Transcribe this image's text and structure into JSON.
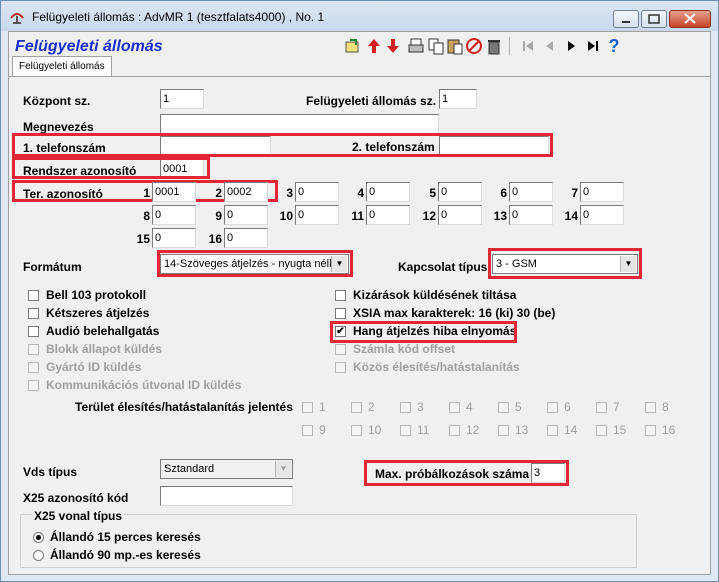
{
  "window": {
    "title": "Felügyeleti állomás : AdvMR 1 (tesztfalats4000) , No. 1"
  },
  "heading": "Felügyeleti állomás",
  "tabs": [
    {
      "label": "Felügyeleti állomás"
    }
  ],
  "fields": {
    "kozpont_label": "Központ sz.",
    "kozpont_value": "1",
    "felugy_label": "Felügyeleti állomás sz.",
    "felugy_value": "1",
    "megnevezes_label": "Megnevezés",
    "megnevezes_value": "",
    "tel1_label": "1. telefonszám",
    "tel1_value": "",
    "tel2_label": "2. telefonszám",
    "tel2_value": "",
    "rendszer_label": "Rendszer azonosító",
    "rendszer_value": "0001",
    "ter_label": "Ter. azonosító"
  },
  "ter_azonosito": [
    {
      "n": "1",
      "v": "0001"
    },
    {
      "n": "2",
      "v": "0002"
    },
    {
      "n": "3",
      "v": "0"
    },
    {
      "n": "4",
      "v": "0"
    },
    {
      "n": "5",
      "v": "0"
    },
    {
      "n": "6",
      "v": "0"
    },
    {
      "n": "7",
      "v": "0"
    },
    {
      "n": "8",
      "v": "0"
    },
    {
      "n": "9",
      "v": "0"
    },
    {
      "n": "10",
      "v": "0"
    },
    {
      "n": "11",
      "v": "0"
    },
    {
      "n": "12",
      "v": "0"
    },
    {
      "n": "13",
      "v": "0"
    },
    {
      "n": "14",
      "v": "0"
    },
    {
      "n": "15",
      "v": "0"
    },
    {
      "n": "16",
      "v": "0"
    }
  ],
  "formatum": {
    "label": "Formátum",
    "value": "14-Szöveges átjelzés - nyugta nélki"
  },
  "kapcsolat": {
    "label": "Kapcsolat típus",
    "value": "3 - GSM"
  },
  "checks_left": [
    {
      "label": "Bell 103 protokoll",
      "checked": false,
      "disabled": false
    },
    {
      "label": "Kétszeres átjelzés",
      "checked": false,
      "disabled": false
    },
    {
      "label": "Audió belehallgatás",
      "checked": false,
      "disabled": false
    },
    {
      "label": "Blokk állapot küldés",
      "checked": false,
      "disabled": true
    },
    {
      "label": "Gyártó ID küldés",
      "checked": false,
      "disabled": true
    },
    {
      "label": "Kommunikációs útvonal ID küldés",
      "checked": false,
      "disabled": true
    }
  ],
  "checks_right": [
    {
      "label": "Kizárások küldésének tiltása",
      "checked": false,
      "disabled": false
    },
    {
      "label": "XSIA max karakterek: 16 (ki) 30 (be)",
      "checked": false,
      "disabled": false
    },
    {
      "label": "Hang átjelzés hiba elnyomás",
      "checked": true,
      "disabled": false
    },
    {
      "label": "Számla kód offset",
      "checked": false,
      "disabled": true
    },
    {
      "label": "Közös élesítés/hatástalanítás",
      "checked": false,
      "disabled": true
    }
  ],
  "terulet": {
    "label": "Terület élesítés/hatástalanítás jelentés",
    "numbers": [
      "1",
      "2",
      "3",
      "4",
      "5",
      "6",
      "7",
      "8",
      "9",
      "10",
      "11",
      "12",
      "13",
      "14",
      "15",
      "16"
    ]
  },
  "vds": {
    "label": "Vds típus",
    "value": "Sztandard"
  },
  "x25": {
    "label": "X25 azonosító kód",
    "value": ""
  },
  "max_prob": {
    "label": "Max. próbálkozások száma",
    "value": "3"
  },
  "x25_vonal": {
    "title": "X25 vonal típus",
    "options": [
      {
        "label": "Állandó 15 perces keresés",
        "selected": true
      },
      {
        "label": "Állandó 90 mp.-es keresés",
        "selected": false
      }
    ]
  },
  "colors": {
    "highlight": "#e32636",
    "heading": "#1a2ed0"
  }
}
